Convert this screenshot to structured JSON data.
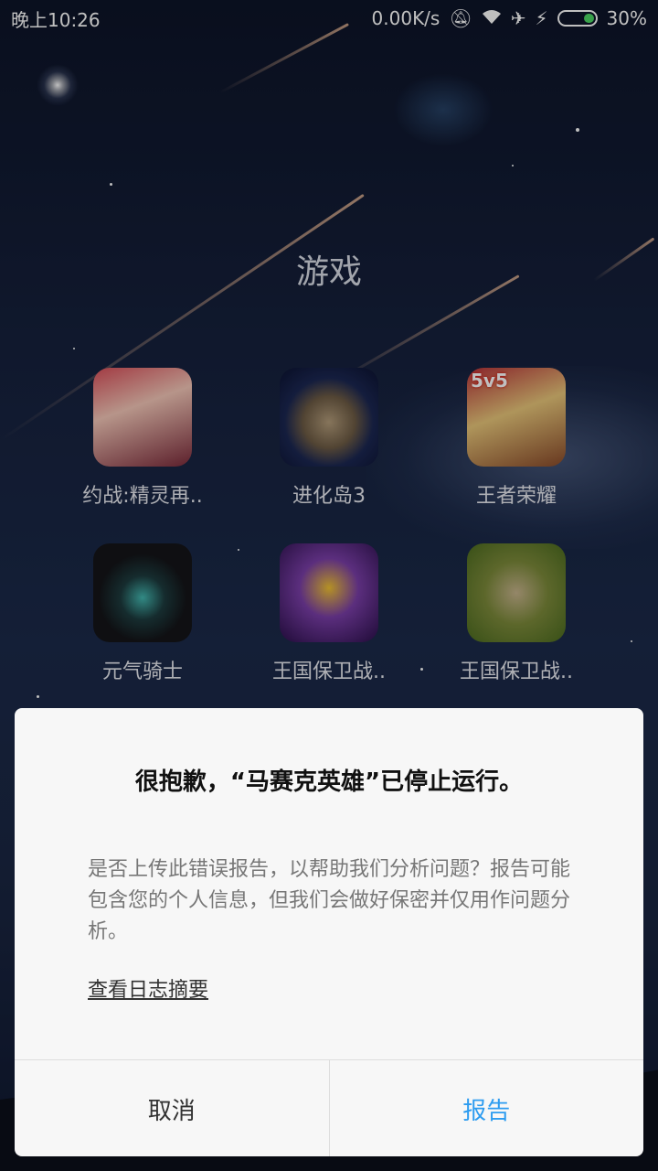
{
  "status_bar": {
    "time": "晚上10:26",
    "network_speed": "0.00K/s",
    "battery_percent": "30%",
    "battery_level": 0.3,
    "icons": [
      "mute-icon",
      "wifi-icon",
      "airplane-mode-icon",
      "charging-icon",
      "battery-icon"
    ]
  },
  "folder": {
    "title": "游戏",
    "apps": [
      {
        "label": "约战:精灵再..",
        "icon": "date-a-live-app-icon"
      },
      {
        "label": "进化岛3",
        "icon": "evolution-island-3-app-icon"
      },
      {
        "label": "王者荣耀",
        "icon": "honor-of-kings-app-icon",
        "badge": "5v5"
      },
      {
        "label": "元气骑士",
        "icon": "soul-knight-app-icon"
      },
      {
        "label": "王国保卫战..",
        "icon": "kingdom-rush-app-icon"
      },
      {
        "label": "王国保卫战..",
        "icon": "kingdom-rush-frontiers-app-icon"
      }
    ]
  },
  "dialog": {
    "title": "很抱歉，“马赛克英雄”已停止运行。",
    "message": "是否上传此错误报告，以帮助我们分析问题？报告可能包含您的个人信息，但我们会做好保密并仅用作问题分析。",
    "view_log_link": "查看日志摘要",
    "cancel_label": "取消",
    "report_label": "报告",
    "report_color": "#2d9cf0"
  }
}
